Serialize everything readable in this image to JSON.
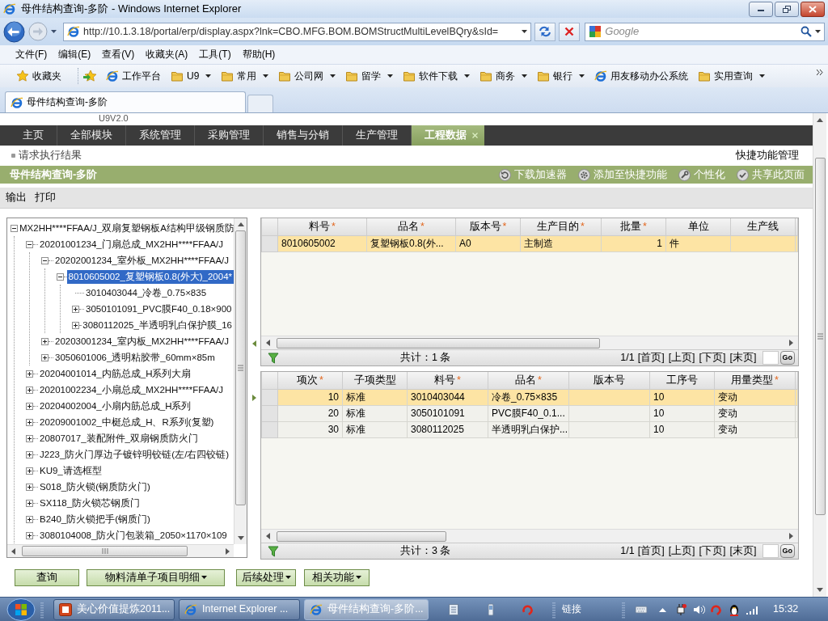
{
  "window": {
    "title": "母件结构查询-多阶 - Windows Internet Explorer"
  },
  "address_bar": {
    "url": "http://10.1.3.18/portal/erp/display.aspx?lnk=CBO.MFG.BOM.BOMStructMultiLevelBQry&sId=",
    "search_placeholder": "Google"
  },
  "menu_bar": [
    "文件(F)",
    "编辑(E)",
    "查看(V)",
    "收藏夹(A)",
    "工具(T)",
    "帮助(H)"
  ],
  "favorites_bar": {
    "label": "收藏夹",
    "items": [
      {
        "label": "工作平台",
        "kind": "page"
      },
      {
        "label": "U9",
        "kind": "folder"
      },
      {
        "label": "常用",
        "kind": "folder"
      },
      {
        "label": "公司网",
        "kind": "folder"
      },
      {
        "label": "留学",
        "kind": "folder"
      },
      {
        "label": "软件下载",
        "kind": "folder"
      },
      {
        "label": "商务",
        "kind": "folder"
      },
      {
        "label": "银行",
        "kind": "folder"
      },
      {
        "label": "用友移动办公系统",
        "kind": "page"
      },
      {
        "label": "实用查询",
        "kind": "folder"
      }
    ]
  },
  "browser_tabs": [
    {
      "label": "母件结构查询-多阶",
      "selected": true
    }
  ],
  "app": {
    "version": "U9V2.0",
    "nav": [
      {
        "label": "主页",
        "selected": false
      },
      {
        "label": "全部模块",
        "selected": false
      },
      {
        "label": "系统管理",
        "selected": false
      },
      {
        "label": "采购管理",
        "selected": false
      },
      {
        "label": "销售与分销",
        "selected": false
      },
      {
        "label": "生产管理",
        "selected": false
      },
      {
        "label": "工程数据",
        "selected": true
      }
    ],
    "breadcrumb": "请求执行结果",
    "shortcut_link": "快捷功能管理"
  },
  "page_header": {
    "title": "母件结构查询-多阶",
    "actions": [
      "下载加速器",
      "添加至快捷功能",
      "个性化",
      "共享此页面"
    ]
  },
  "toolbar": [
    "输出",
    "打印"
  ],
  "tree": [
    {
      "label": "MX2HH****FFAA/J_双扇复塑钢板A结构甲级钢质防",
      "expanded": true,
      "selected": false,
      "children": [
        {
          "label": "20201001234_门扇总成_MX2HH****FFAA/J",
          "expanded": true,
          "selected": false,
          "children": [
            {
              "label": "20202001234_室外板_MX2HH****FFAA/J",
              "expanded": true,
              "selected": false,
              "children": [
                {
                  "label": "8010605002_复塑钢板0.8(外大)_2004*",
                  "expanded": true,
                  "selected": true,
                  "children": [
                    {
                      "label": "3010403044_冷卷_0.75×835",
                      "selected": false
                    },
                    {
                      "label": "3050101091_PVC膜F40_0.18×900",
                      "expanded": false,
                      "selected": false
                    },
                    {
                      "label": "3080112025_半透明乳白保护膜_16",
                      "expanded": false,
                      "selected": false
                    }
                  ]
                }
              ]
            },
            {
              "label": "20203001234_室内板_MX2HH****FFAA/J",
              "expanded": false,
              "selected": false
            },
            {
              "label": "3050601006_透明粘胶带_60mm×85m",
              "expanded": false,
              "selected": false
            }
          ]
        },
        {
          "label": "20204001014_内筋总成_H系列大扇",
          "expanded": false,
          "selected": false
        },
        {
          "label": "20201002234_小扇总成_MX2HH****FFAA/J",
          "expanded": false,
          "selected": false
        },
        {
          "label": "20204002004_小扇内筋总成_H系列",
          "expanded": false,
          "selected": false
        },
        {
          "label": "20209001002_中梃总成_H、R系列(复塑)",
          "expanded": false,
          "selected": false
        },
        {
          "label": "20807017_装配附件_双扇钢质防火门",
          "expanded": false,
          "selected": false
        },
        {
          "label": "J223_防火门厚边子镀锌明铰链(左/右四铰链)",
          "expanded": false,
          "selected": false
        },
        {
          "label": "KU9_请选框型",
          "expanded": false,
          "selected": false
        },
        {
          "label": "S018_防火锁(钢质防火门)",
          "expanded": false,
          "selected": false
        },
        {
          "label": "SX118_防火锁芯钢质门",
          "expanded": false,
          "selected": false
        },
        {
          "label": "B240_防火锁把手(钢质门)",
          "expanded": false,
          "selected": false
        },
        {
          "label": "3080104008_防火门包装箱_2050×1170×109",
          "expanded": false,
          "selected": false
        }
      ]
    }
  ],
  "header_grid": {
    "focused": false,
    "columns": [
      {
        "label": "料号",
        "mark": "*",
        "kind": "text"
      },
      {
        "label": "品名",
        "mark": "*",
        "kind": "text"
      },
      {
        "label": "版本号",
        "mark": "*",
        "kind": "text"
      },
      {
        "label": "生产目的",
        "mark": "*",
        "kind": "text"
      },
      {
        "label": "批量",
        "mark": "*",
        "kind": "number"
      },
      {
        "label": "单位",
        "kind": "text"
      },
      {
        "label": "生产线",
        "kind": "text"
      }
    ],
    "rows": [
      {
        "selected": true,
        "cells": [
          "8010605002",
          "复塑钢板0.8(外...",
          "A0",
          "主制造",
          "1",
          "件",
          null
        ]
      }
    ],
    "total": "共计：1 条",
    "page": "1/1",
    "pager_links": [
      "[首页]",
      "[上页]",
      "[下页]",
      "[末页]"
    ],
    "go": "Go"
  },
  "detail_grid": {
    "focused": true,
    "columns": [
      {
        "label": "项次",
        "mark": "*",
        "kind": "number"
      },
      {
        "label": "子项类型",
        "kind": "text"
      },
      {
        "label": "料号",
        "mark": "*",
        "kind": "text"
      },
      {
        "label": "品名",
        "mark": "*",
        "kind": "text"
      },
      {
        "label": "版本号",
        "kind": "text"
      },
      {
        "label": "工序号",
        "kind": "text"
      },
      {
        "label": "用量类型",
        "mark": "*",
        "kind": "text"
      }
    ],
    "rows": [
      {
        "selected": true,
        "cells": [
          "10",
          "标准",
          "3010403044",
          "冷卷_0.75×835",
          null,
          "10",
          "变动"
        ]
      },
      {
        "selected": false,
        "cells": [
          "20",
          "标准",
          "3050101091",
          "PVC膜F40_0.1...",
          null,
          "10",
          "变动"
        ]
      },
      {
        "selected": false,
        "cells": [
          "30",
          "标准",
          "3080112025",
          "半透明乳白保护...",
          null,
          "10",
          "变动"
        ]
      }
    ],
    "total": "共计：3 条",
    "page": "1/1",
    "pager_links": [
      "[首页]",
      "[上页]",
      "[下页]",
      "[末页]"
    ],
    "go": "Go"
  },
  "buttons": [
    {
      "label": "查询",
      "dropdown": false
    },
    {
      "label": "物料清单子项目明细",
      "dropdown": true
    },
    {
      "label": "后续处理",
      "dropdown": true
    },
    {
      "label": "相关功能",
      "dropdown": true
    }
  ],
  "taskbar": {
    "tasks": [
      {
        "label": "美心价值提炼2011...",
        "kind": "presentation",
        "selected": false
      },
      {
        "label": "Internet Explorer ...",
        "kind": "browser",
        "selected": false
      },
      {
        "label": "母件结构查询-多阶...",
        "kind": "browser",
        "selected": true
      }
    ],
    "links_label": "链接",
    "clock": "15:32"
  }
}
